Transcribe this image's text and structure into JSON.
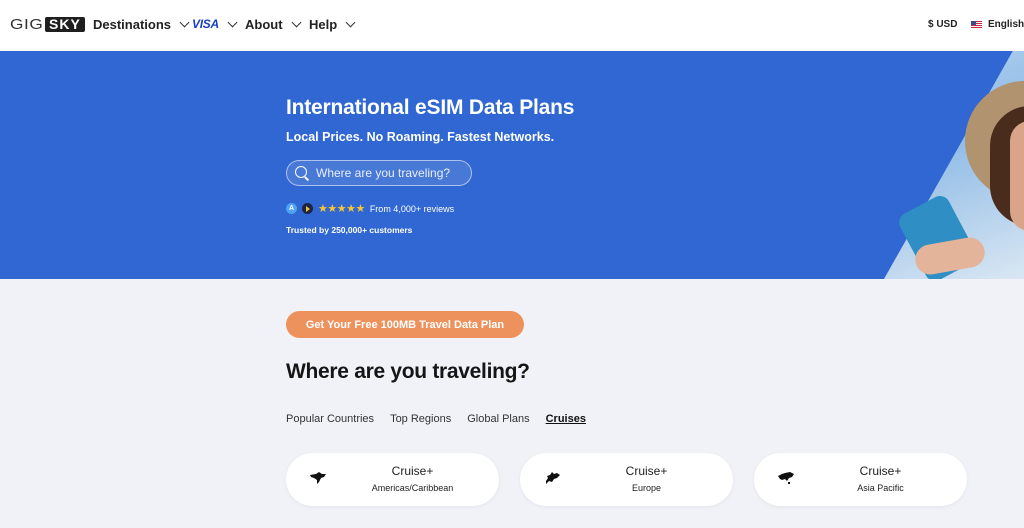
{
  "nav": {
    "logo": {
      "part1": "GIG",
      "part2": "SKY"
    },
    "items": [
      {
        "label": "Destinations"
      },
      {
        "label": "VISA"
      },
      {
        "label": "About"
      },
      {
        "label": "Help"
      }
    ],
    "currency": "$ USD",
    "language": "English"
  },
  "hero": {
    "title": "International eSIM Data Plans",
    "subtitle": "Local Prices. No Roaming. Fastest Networks.",
    "search_placeholder": "Where are you traveling?",
    "stars": "★★★★★",
    "rating": 5,
    "reviews_text": "From 4,000+ reviews",
    "trusted_text": "Trusted by 250,000+ customers"
  },
  "main": {
    "cta_label": "Get Your Free 100MB Travel Data Plan",
    "section_title": "Where are you traveling?",
    "tabs": [
      {
        "label": "Popular Countries",
        "active": false
      },
      {
        "label": "Top Regions",
        "active": false
      },
      {
        "label": "Global Plans",
        "active": false
      },
      {
        "label": "Cruises",
        "active": true
      }
    ],
    "cards": [
      {
        "title": "Cruise+",
        "subtitle": "Americas/Caribbean",
        "icon": "americas-map-icon"
      },
      {
        "title": "Cruise+",
        "subtitle": "Europe",
        "icon": "europe-map-icon"
      },
      {
        "title": "Cruise+",
        "subtitle": "Asia Pacific",
        "icon": "asia-pacific-map-icon"
      }
    ]
  },
  "colors": {
    "hero_blue": "#3067d2",
    "cta_orange": "#ed925d",
    "visa_blue": "#1a3fbf",
    "page_bg": "#f1f2f8"
  }
}
